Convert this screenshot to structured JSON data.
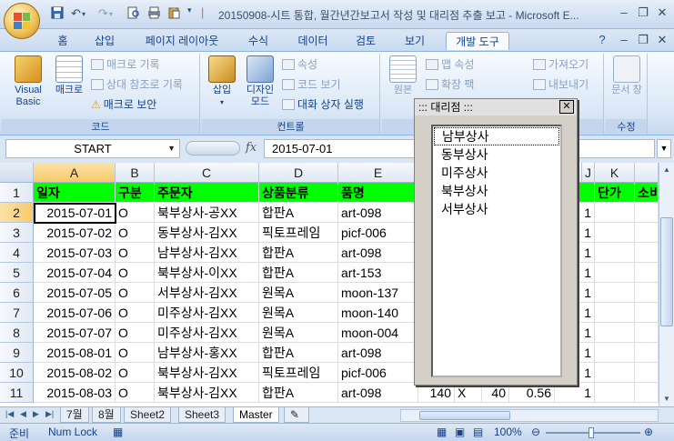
{
  "window": {
    "title": "20150908-시트 통합, 월간년간보고서 작성 및 대리점 추출 보고 - Microsoft E...",
    "quick_access": [
      "save-icon",
      "undo-icon",
      "redo-icon",
      "print-preview-icon",
      "print-icon",
      "paste-special-icon"
    ]
  },
  "ribbon_tabs": [
    "홈",
    "삽입",
    "페이지 레이아웃",
    "수식",
    "데이터",
    "검토",
    "보기",
    "개발 도구"
  ],
  "active_tab": "개발 도구",
  "ribbon": {
    "code": {
      "label": "코드",
      "visual_basic": "Visual Basic",
      "macro": "매크로",
      "record_macro": "매크로 기록",
      "relative_ref": "상대 참조로 기록",
      "macro_security": "매크로 보안"
    },
    "controls": {
      "label": "컨트롤",
      "insert": "삽입",
      "design_mode": "디자인 모드",
      "properties": "속성",
      "view_code": "코드 보기",
      "run_dialog": "대화 상자 실행"
    },
    "xml": {
      "source": "원본",
      "map_props": "맵 속성",
      "expansion_packs": "확장 팩",
      "import": "가져오기",
      "export": "내보내기"
    },
    "modify": {
      "label": "수정",
      "doc_pane": "문서 창"
    }
  },
  "formula_bar": {
    "name_box": "START",
    "fx": "fx",
    "value": "2015-07-01"
  },
  "columns": [
    "A",
    "B",
    "C",
    "D",
    "E",
    "J",
    "K"
  ],
  "header_row": {
    "row_num": "1",
    "cells": [
      "일자",
      "구분",
      "주문자",
      "상품분류",
      "품명",
      "량",
      "단가",
      "소비"
    ]
  },
  "rows": [
    {
      "n": "2",
      "a": "2015-07-01",
      "b": "O",
      "c": "북부상사-공XX",
      "d": "합판A",
      "e": "art-098",
      "j": "1"
    },
    {
      "n": "3",
      "a": "2015-07-02",
      "b": "O",
      "c": "동부상사-김XX",
      "d": "픽토프레임",
      "e": "picf-006",
      "j": "1"
    },
    {
      "n": "4",
      "a": "2015-07-03",
      "b": "O",
      "c": "남부상사-김XX",
      "d": "합판A",
      "e": "art-098",
      "j": "1"
    },
    {
      "n": "5",
      "a": "2015-07-04",
      "b": "O",
      "c": "북부상사-이XX",
      "d": "합판A",
      "e": "art-153",
      "j": "1"
    },
    {
      "n": "6",
      "a": "2015-07-05",
      "b": "O",
      "c": "서부상사-김XX",
      "d": "원목A",
      "e": "moon-137",
      "j": "1"
    },
    {
      "n": "7",
      "a": "2015-07-06",
      "b": "O",
      "c": "미주상사-김XX",
      "d": "원목A",
      "e": "moon-140",
      "j": "1"
    },
    {
      "n": "8",
      "a": "2015-07-07",
      "b": "O",
      "c": "미주상사-김XX",
      "d": "원목A",
      "e": "moon-004",
      "j": "1"
    },
    {
      "n": "9",
      "a": "2015-08-01",
      "b": "O",
      "c": "남부상사-홍XX",
      "d": "합판A",
      "e": "art-098",
      "j": "1"
    },
    {
      "n": "10",
      "a": "2015-08-02",
      "b": "O",
      "c": "북부상사-김XX",
      "d": "픽토프레임",
      "e": "picf-006",
      "j": "1"
    },
    {
      "n": "11",
      "a": "2015-08-03",
      "b": "O",
      "c": "북부상사-김XX",
      "d": "합판A",
      "e": "art-098",
      "f": "140",
      "g": "X",
      "h": "40",
      "i": "0.56",
      "j": "1"
    }
  ],
  "sheet_tabs": [
    "7월",
    "8월",
    "Sheet2",
    "Sheet3",
    "Master"
  ],
  "active_sheet": "Master",
  "status": {
    "ready": "준비",
    "num_lock": "Num Lock",
    "zoom": "100%"
  },
  "form": {
    "title": "::: 대리점 :::",
    "close": "✕",
    "items": [
      "남부상사",
      "동부상사",
      "미주상사",
      "북부상사",
      "서부상사"
    ]
  },
  "colors": {
    "header_fill": "#00ff00",
    "ribbon_text": "#15428b"
  }
}
